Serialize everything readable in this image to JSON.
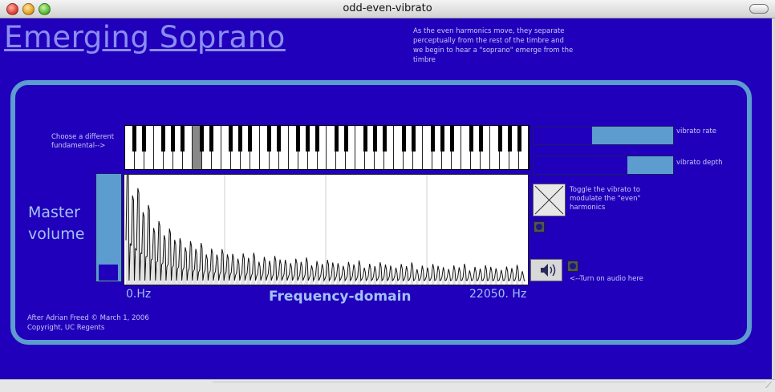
{
  "window": {
    "title": "odd-even-vibrato"
  },
  "header": {
    "title": "Emerging Soprano",
    "description": "As the even harmonics move, they separate perceptually from the rest of the timbre and we begin to hear a \"soprano\" emerge from the timbre"
  },
  "piano": {
    "label": "Choose a different fundamental-->",
    "selected_key_index": 7,
    "white_key_count": 42
  },
  "volume": {
    "label_line1": "Master",
    "label_line2": "volume",
    "level": 0.15
  },
  "spectrum": {
    "xmin_label": "0.Hz",
    "xmax_label": "22050. Hz",
    "axis_label": "Frequency-domain"
  },
  "controls": {
    "vibrato_rate": {
      "label": "vibrato rate",
      "value": 0.42
    },
    "vibrato_depth": {
      "label": "vibrato depth",
      "value": 0.67
    },
    "toggle_label": "Toggle the vibrato to modulate the \"even\" harmonics",
    "audio_label": "<--Turn on audio here"
  },
  "credit": "After Adrian Freed © March 1, 2006 Copyright, UC Regents",
  "colors": {
    "background": "#2100bb",
    "accent": "#5d9ccf",
    "text_light": "#a3c2f5"
  }
}
